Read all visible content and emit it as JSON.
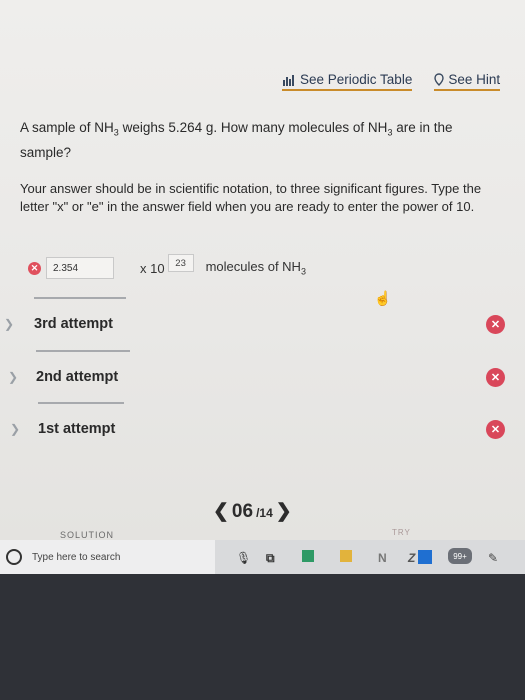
{
  "links": {
    "periodic_table": "See Periodic Table",
    "hint": "See Hint"
  },
  "question": {
    "part1": "A sample of NH",
    "sub1": "3",
    "part2": " weighs 5.264 g. How many molecules of NH",
    "sub2": "3",
    "part3": " are in the sample?"
  },
  "instructions": "Your answer should be in scientific notation, to three significant figures. Type the letter \"x\" or \"e\" in the answer field when you are ready to enter the power of 10.",
  "answer": {
    "coefficient": "2.354",
    "times": "x 10",
    "exponent": "23",
    "unit_prefix": "molecules of NH",
    "unit_sub": "3"
  },
  "attempts": [
    {
      "label": "3rd attempt"
    },
    {
      "label": "2nd attempt"
    },
    {
      "label": "1st attempt"
    }
  ],
  "pager": {
    "current": "06",
    "total": "/14"
  },
  "solution_label": "SOLUTION",
  "try_label": "TRY",
  "taskbar": {
    "search_placeholder": "Type here to search",
    "badge": "99+"
  },
  "colors": {
    "error": "#d9475a",
    "link_underline": "#c98b2a"
  }
}
